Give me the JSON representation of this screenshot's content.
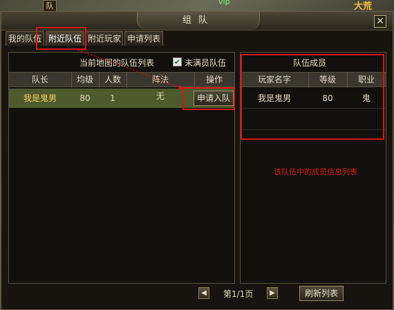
{
  "background": {
    "badge": "队",
    "vip_text": "vip",
    "corner_text": "大荒"
  },
  "window": {
    "title": "组队",
    "close_glyph": "✕"
  },
  "tabs": [
    {
      "label": "我的队伍",
      "active": false
    },
    {
      "label": "附近队伍",
      "active": true
    },
    {
      "label": "附近玩家",
      "active": false
    },
    {
      "label": "申请列表",
      "active": false
    }
  ],
  "team_list": {
    "title": "当前地图的队伍列表",
    "filter_label": "未满员队伍",
    "filter_checked": true,
    "columns": [
      "队长",
      "均级",
      "人数",
      "阵法",
      "操作"
    ],
    "rows": [
      {
        "leader": "我是鬼男",
        "avg_level": "80",
        "members": "1",
        "formation": "无",
        "action": "申请入队"
      }
    ]
  },
  "member_list": {
    "title": "队伍成员",
    "columns": [
      "玩家名字",
      "等级",
      "职业"
    ],
    "rows": [
      {
        "name": "我是鬼男",
        "level": "80",
        "job": "鬼"
      }
    ],
    "annotation": "该队伍中的成员信息列表"
  },
  "pagination": {
    "prev_glyph": "◀",
    "page_text": "第1/1页",
    "next_glyph": "▶",
    "refresh_label": "刷新列表"
  },
  "colors": {
    "highlight": "#d8141c",
    "selected_row": "#4f5a2c",
    "leader_text": "#f0d060"
  }
}
